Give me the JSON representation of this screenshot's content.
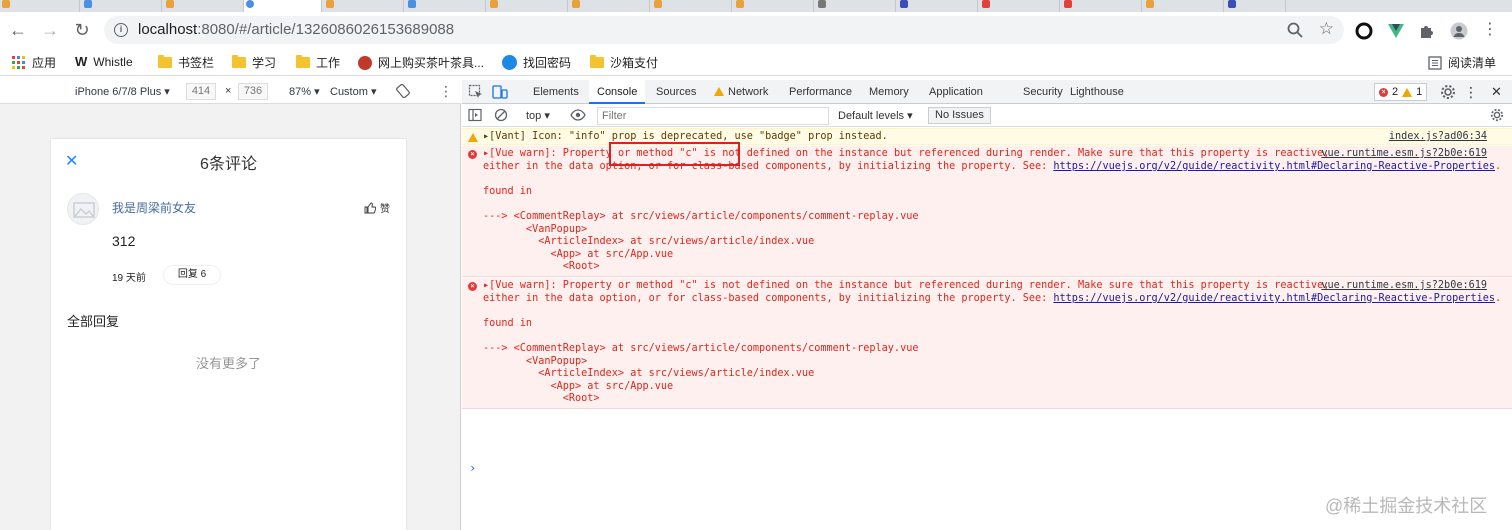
{
  "browser": {
    "url_host": "localhost",
    "url_path": ":8080/#/article/1326086026153689088"
  },
  "bookmarks": [
    {
      "label": "应用",
      "icon": "apps-grid-icon"
    },
    {
      "label": "Whistle",
      "icon": "whistle-logo-icon"
    },
    {
      "label": "书签栏",
      "icon": "folder-icon"
    },
    {
      "label": "学习",
      "icon": "folder-icon"
    },
    {
      "label": "工作",
      "icon": "folder-icon"
    },
    {
      "label": "网上购买茶叶茶具...",
      "icon": "tea-site-icon"
    },
    {
      "label": "找回密码",
      "icon": "key-site-icon"
    },
    {
      "label": "沙箱支付",
      "icon": "folder-icon"
    }
  ],
  "reading_list": "阅读清单",
  "device_toolbar": {
    "device": "iPhone 6/7/8 Plus",
    "width": "414",
    "times": "×",
    "height": "736",
    "zoom": "87%",
    "throttle": "Custom"
  },
  "phone": {
    "title": "6条评论",
    "username": "我是周梁前女友",
    "like_label": "赞",
    "content": "312",
    "time": "19 天前",
    "reply_label": "回复 6",
    "all_replies": "全部回复",
    "no_more": "没有更多了"
  },
  "devtools": {
    "tabs": [
      "Elements",
      "Console",
      "Sources",
      "Network",
      "Performance",
      "Memory",
      "Application",
      "Security",
      "Lighthouse"
    ],
    "active_tab": "Console",
    "error_count": "2",
    "warning_count": "1",
    "context": "top",
    "filter_placeholder": "Filter",
    "levels": "Default levels",
    "issues": "No Issues"
  },
  "console": {
    "warn": {
      "text": "[Vant] Icon: \"info\" prop is deprecated, use \"badge\" prop instead.",
      "source": "index.js?ad06:34"
    },
    "errors": [
      {
        "line1": "[Vue warn]: Property or method \"c\" is not defined on the instance but referenced during render. Make sure that this property is reactive,",
        "line2_prefix": "either in the data option, or for class-based components, by initializing the property. See: ",
        "link": "https://vuejs.org/v2/guide/reactivity.html#Declaring-Reactive-Properties",
        "line2_suffix": ".",
        "found_in": "found in",
        "trace": [
          "---> <CommentReplay> at src/views/article/components/comment-replay.vue",
          "       <VanPopup>",
          "         <ArticleIndex> at src/views/article/index.vue",
          "           <App> at src/App.vue",
          "             <Root>"
        ],
        "source": "vue.runtime.esm.js?2b0e:619"
      },
      {
        "line1": "[Vue warn]: Property or method \"c\" is not defined on the instance but referenced during render. Make sure that this property is reactive,",
        "line2_prefix": "either in the data option, or for class-based components, by initializing the property. See: ",
        "link": "https://vuejs.org/v2/guide/reactivity.html#Declaring-Reactive-Properties",
        "line2_suffix": ".",
        "found_in": "found in",
        "trace": [
          "---> <CommentReplay> at src/views/article/components/comment-replay.vue",
          "       <VanPopup>",
          "         <ArticleIndex> at src/views/article/index.vue",
          "           <App> at src/App.vue",
          "             <Root>"
        ],
        "source": "vue.runtime.esm.js?2b0e:619"
      }
    ],
    "prompt": "›"
  },
  "watermark": "@稀土掘金技术社区",
  "colors": {
    "error_text": "#e0261a",
    "error_bg": "#fff0f0",
    "warn_bg": "#fffbe5",
    "accent": "#1a73e8",
    "highlight_box": "#e02020"
  }
}
